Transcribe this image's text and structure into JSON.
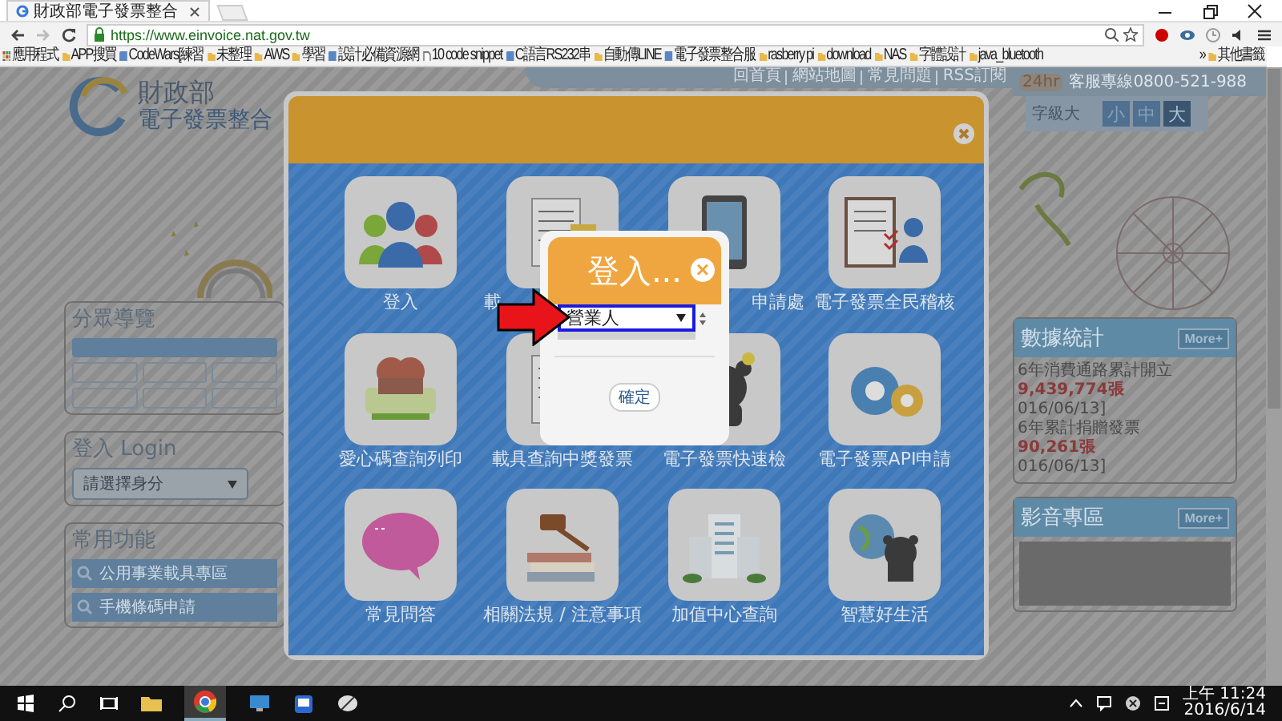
{
  "browser": {
    "tab_title": "財政部電子發票整合",
    "url": "https://www.einvoice.nat.gov.tw",
    "bookmarks": [
      {
        "label": "應用程式",
        "kind": "apps"
      },
      {
        "label": "APP搜買",
        "kind": "folder"
      },
      {
        "label": "CodeWars[練習",
        "kind": "site"
      },
      {
        "label": "未整理",
        "kind": "folder"
      },
      {
        "label": "AWS",
        "kind": "folder"
      },
      {
        "label": "學習",
        "kind": "folder"
      },
      {
        "label": "設計必備資源網",
        "kind": "site"
      },
      {
        "label": "10 code snippet",
        "kind": "page"
      },
      {
        "label": "C語言RS232串",
        "kind": "site"
      },
      {
        "label": "自動傳LINE",
        "kind": "folder"
      },
      {
        "label": "電子發票整合服",
        "kind": "site"
      },
      {
        "label": "rasberry pi",
        "kind": "folder"
      },
      {
        "label": "download",
        "kind": "folder"
      },
      {
        "label": "NAS",
        "kind": "folder"
      },
      {
        "label": "字體設計",
        "kind": "folder"
      },
      {
        "label": "java_bluetooth",
        "kind": "folder"
      }
    ],
    "more": "»",
    "other_bookmarks": "其他書籤"
  },
  "site": {
    "logo_title": "財政部",
    "logo_subtitle": "電子發票整合",
    "top_links": [
      "回首頁",
      "網站地圖",
      "常見問題",
      "RSS訂閱"
    ],
    "hotline_tag": "24hr",
    "hotline": "客服專線0800-521-988",
    "font_size_label": "字級大",
    "font_sizes": [
      {
        "label": "小",
        "selected": false
      },
      {
        "label": "中",
        "selected": false
      },
      {
        "label": "大",
        "selected": true
      }
    ],
    "nav_panel": {
      "title": "分眾導覽"
    },
    "login_panel": {
      "title": "登入 Login",
      "placeholder": "請選擇身分"
    },
    "common_panel": {
      "title": "常用功能",
      "items": [
        "公用事業載具專區",
        "手機條碼申請"
      ]
    },
    "stats_panel": {
      "title": "數據統計",
      "more": "More+",
      "lines": [
        {
          "text": "6年消費通路累計開立",
          "kind": "label"
        },
        {
          "text": "9,439,774張",
          "kind": "value"
        },
        {
          "text": "016/06/13]",
          "kind": "label"
        },
        {
          "text": "6年累計捐贈發票",
          "kind": "label"
        },
        {
          "text": "90,261張",
          "kind": "value"
        },
        {
          "text": "016/06/13]",
          "kind": "label"
        }
      ]
    },
    "media_panel": {
      "title": "影音專區",
      "more": "More+"
    }
  },
  "modal": {
    "tiles": [
      {
        "label": "登入",
        "kind": "people"
      },
      {
        "label": "載",
        "kind": "receipt"
      },
      {
        "label": "申請處",
        "kind": "phone"
      },
      {
        "label": "電子發票全民稽核",
        "kind": "audit"
      },
      {
        "label": "愛心碼查詢列印",
        "kind": "printer"
      },
      {
        "label": "載具查詢中獎發票",
        "kind": "receipt"
      },
      {
        "label": "電子發票快速檢",
        "kind": "bear"
      },
      {
        "label": "電子發票API申請",
        "kind": "gears"
      },
      {
        "label": "常見問答",
        "kind": "qa"
      },
      {
        "label": "相關法規 / 注意事項",
        "kind": "books"
      },
      {
        "label": "加值中心查詢",
        "kind": "building"
      },
      {
        "label": "智慧好生活",
        "kind": "globe"
      }
    ]
  },
  "login_popup": {
    "title": "登入...",
    "close": "×",
    "role": "營業人",
    "submit": "確定"
  },
  "taskbar": {
    "time": "上午 11:24",
    "date": "2016/6/14"
  }
}
